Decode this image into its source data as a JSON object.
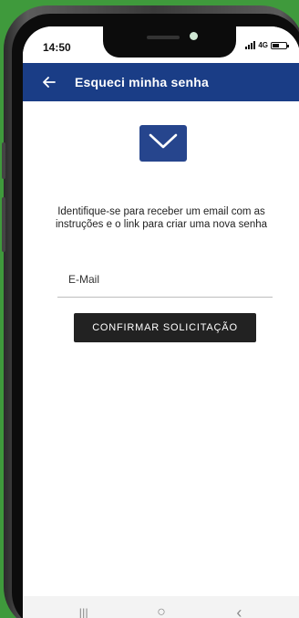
{
  "status_bar": {
    "time": "14:50",
    "network": "4G",
    "icons": [
      "signal-icon",
      "battery-icon"
    ]
  },
  "app_bar": {
    "title": "Esqueci minha senha",
    "back_icon": "arrow-left-icon",
    "color": "#1a3d86"
  },
  "content": {
    "icon": "envelope-icon",
    "icon_color": "#26458d",
    "description": "Identifique-se para receber um email com as instruções e o link para criar uma nova senha",
    "email_placeholder": "E-Mail",
    "email_value": "",
    "confirm_label": "CONFIRMAR SOLICITAÇÃO",
    "button_color": "#222222"
  },
  "nav_bar": {
    "items": [
      {
        "icon": "recent-apps-icon",
        "glyph": "|||"
      },
      {
        "icon": "home-icon",
        "glyph": "○"
      },
      {
        "icon": "back-icon",
        "glyph": "‹"
      }
    ]
  },
  "background_color": "#3f9a3c"
}
